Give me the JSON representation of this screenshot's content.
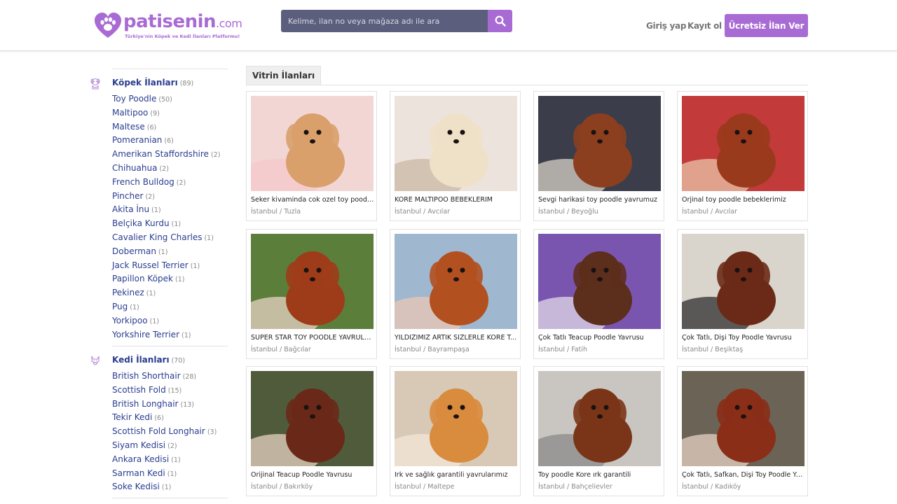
{
  "brand": {
    "name": "patisenin",
    "tld": ".com",
    "tagline": "Türkiye'nin Köpek ve Kedi İlanları Platformu!",
    "color": "#a86bd4"
  },
  "search": {
    "placeholder": "Kelime, ilan no veya mağaza adı ile ara",
    "icon": "search-icon"
  },
  "nav": {
    "login": "Giriş yap",
    "register": "Kayıt ol",
    "cta": "Ücretsiz İlan Ver"
  },
  "sidebar": {
    "dogs": {
      "title": "Köpek İlanları",
      "count": "(89)",
      "icon": "dog-icon",
      "items": [
        {
          "label": "Toy Poodle",
          "count": "(50)"
        },
        {
          "label": "Maltipoo",
          "count": "(9)"
        },
        {
          "label": "Maltese",
          "count": "(6)"
        },
        {
          "label": "Pomeranian",
          "count": "(6)"
        },
        {
          "label": "Amerikan Staffordshire",
          "count": "(2)"
        },
        {
          "label": "Chihuahua",
          "count": "(2)"
        },
        {
          "label": "French Bulldog",
          "count": "(2)"
        },
        {
          "label": "Pincher",
          "count": "(2)"
        },
        {
          "label": "Akita İnu",
          "count": "(1)"
        },
        {
          "label": "Belçika Kurdu",
          "count": "(1)"
        },
        {
          "label": "Cavalier King Charles",
          "count": "(1)"
        },
        {
          "label": "Doberman",
          "count": "(1)"
        },
        {
          "label": "Jack Russel Terrier",
          "count": "(1)"
        },
        {
          "label": "Papillon Köpek",
          "count": "(1)"
        },
        {
          "label": "Pekinez",
          "count": "(1)"
        },
        {
          "label": "Pug",
          "count": "(1)"
        },
        {
          "label": "Yorkipoo",
          "count": "(1)"
        },
        {
          "label": "Yorkshire Terrier",
          "count": "(1)"
        }
      ]
    },
    "cats": {
      "title": "Kedi İlanları",
      "count": "(70)",
      "icon": "cat-icon",
      "items": [
        {
          "label": "British Shorthair",
          "count": "(28)"
        },
        {
          "label": "Scottish Fold",
          "count": "(15)"
        },
        {
          "label": "British Longhair",
          "count": "(13)"
        },
        {
          "label": "Tekir Kedi",
          "count": "(6)"
        },
        {
          "label": "Scottish Fold Longhair",
          "count": "(3)"
        },
        {
          "label": "Siyam Kedisi",
          "count": "(2)"
        },
        {
          "label": "Ankara Kedisi",
          "count": "(1)"
        },
        {
          "label": "Sarman Kedi",
          "count": "(1)"
        },
        {
          "label": "Soke Kedisi",
          "count": "(1)"
        }
      ]
    }
  },
  "main": {
    "tab": "Vitrin İlanları",
    "listings": [
      {
        "title": "Seker kivaminda cok ozel toy poodle...",
        "location": "İstanbul / Tuzla",
        "photo": {
          "bg": "#f1d6d4",
          "fur": "#d9a06c",
          "accent": "#f6c8cc"
        }
      },
      {
        "title": "KORE MALTIPOO BEBEKLERIM",
        "location": "İstanbul / Avcılar",
        "photo": {
          "bg": "#ece4dc",
          "fur": "#efe0c8",
          "accent": "#c9b8a6"
        }
      },
      {
        "title": "Sevgi harikasi toy poodle yavrumuz",
        "location": "İstanbul / Beyoğlu",
        "photo": {
          "bg": "#3b3e4a",
          "fur": "#8c3f1f",
          "accent": "#d7d2c8"
        }
      },
      {
        "title": "Orjinal toy poodle bebeklerimiz",
        "location": "İstanbul / Avcılar",
        "photo": {
          "bg": "#c23a3a",
          "fur": "#9a3a1c",
          "accent": "#e9c4a9"
        }
      },
      {
        "title": "SUPER STAR TOY POODLE YAVRULA...",
        "location": "İstanbul / Bağcılar",
        "photo": {
          "bg": "#5b7f3a",
          "fur": "#9e3c1a",
          "accent": "#e8d2c4"
        }
      },
      {
        "title": "YILDIZIMIZ ARTIK SIZLERLE KORE T...",
        "location": "İstanbul / Bayrampaşa",
        "photo": {
          "bg": "#9fb8cf",
          "fur": "#b2501f",
          "accent": "#e9c7b4"
        }
      },
      {
        "title": "Çok Tatlı Teacup Poodle Yavrusu",
        "location": "İstanbul / Fatih",
        "photo": {
          "bg": "#7a55b0",
          "fur": "#5c2e1c",
          "accent": "#e2d9e8"
        }
      },
      {
        "title": "Çok Tatlı, Dişi Toy Poodle Yavrusu",
        "location": "İstanbul / Beşiktaş",
        "photo": {
          "bg": "#d9d4cc",
          "fur": "#6b2a17",
          "accent": "#2f2f2f"
        }
      },
      {
        "title": "Orijinal Teacup Poodle Yavrusu",
        "location": "İstanbul / Bakırköy",
        "photo": {
          "bg": "#4f5b3a",
          "fur": "#6a2818",
          "accent": "#e6d2c4"
        }
      },
      {
        "title": "Irk ve sağlık garantili yavrularımız",
        "location": "İstanbul / Maltepe",
        "photo": {
          "bg": "#d8c9b6",
          "fur": "#d98b3e",
          "accent": "#f3e6d8"
        }
      },
      {
        "title": "Toy poodle Kore ırk garantili",
        "location": "İstanbul / Bahçelievler",
        "photo": {
          "bg": "#c9c6c2",
          "fur": "#7a3518",
          "accent": "#8a8a8a"
        }
      },
      {
        "title": "Çok Tatlı, Safkan, Dişi Toy Poodle Ya...",
        "location": "İstanbul / Kadıköy",
        "photo": {
          "bg": "#6b6456",
          "fur": "#8a2e18",
          "accent": "#e6d2c4"
        }
      }
    ]
  }
}
